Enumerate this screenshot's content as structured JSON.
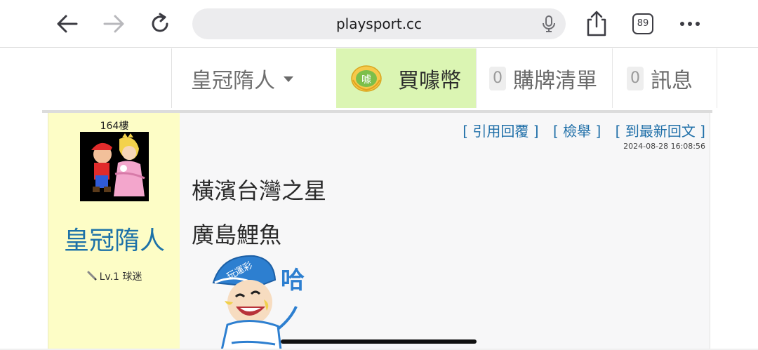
{
  "browser": {
    "url": "playsport.cc",
    "tab_count": "89",
    "icons": [
      "back-arrow-icon",
      "forward-arrow-icon",
      "reload-icon",
      "microphone-icon",
      "share-icon",
      "tabs-icon",
      "more-icon"
    ]
  },
  "header": {
    "user_name": "皇冠隋人",
    "buy_label": "買噱幣",
    "coin_text": "噱",
    "cart_count": "0",
    "cart_label": "購牌清單",
    "msg_count": "0",
    "msg_label": "訊息",
    "buy_bg_color": "#dbf5b3"
  },
  "post": {
    "floor": "164樓",
    "poster_name": "皇冠隋人",
    "level": "Lv.1 球迷",
    "actions": {
      "quote": "引用回覆",
      "report": "檢舉",
      "latest": "到最新回文"
    },
    "timestamp": "2024-08-28 16:08:56",
    "lines": [
      "橫濱台灣之星",
      "廣島鯉魚"
    ],
    "sticker_text": "哈",
    "sticker_badge": "玩運彩",
    "colors": {
      "left_panel": "#fdfdc6",
      "name": "#1d72a8",
      "link": "#1f6fa8"
    }
  }
}
